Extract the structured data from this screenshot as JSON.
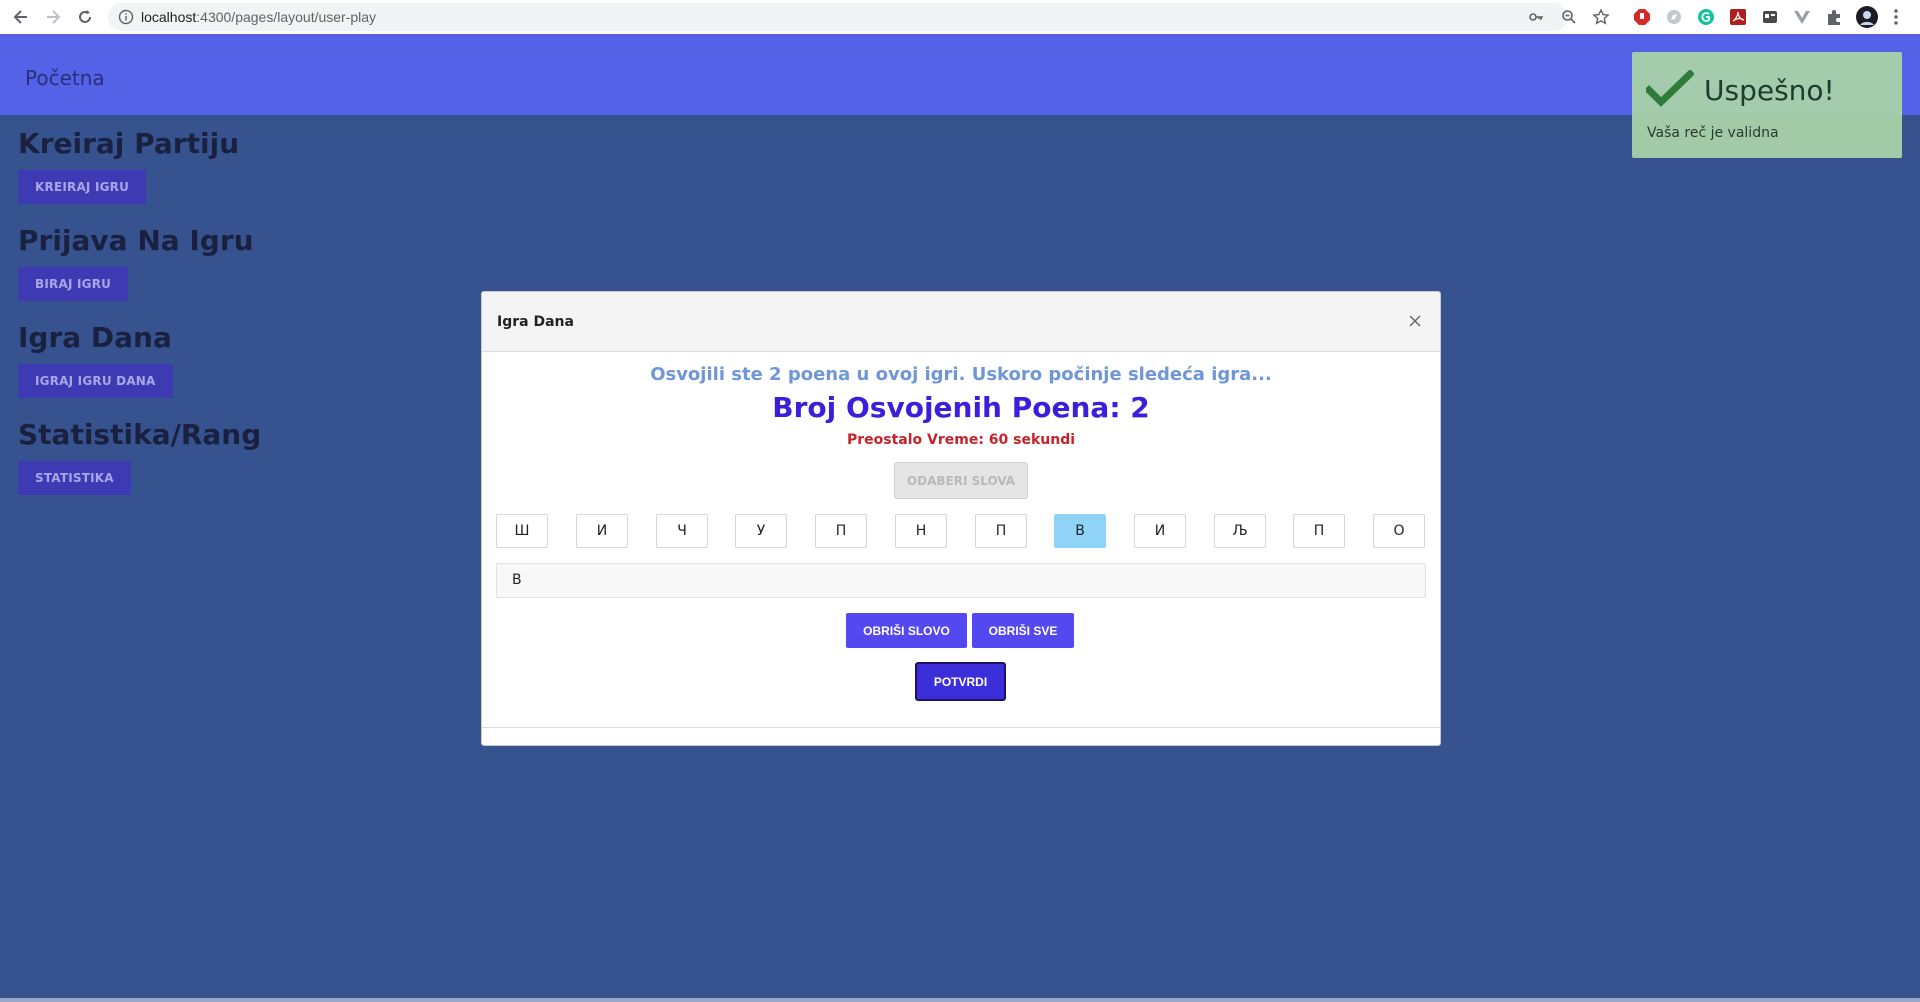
{
  "browser": {
    "url_host": "localhost",
    "url_path": ":4300/pages/layout/user-play"
  },
  "header": {
    "brand": "Početna"
  },
  "sections": [
    {
      "title": "Kreiraj Partiju",
      "button": "KREIRAJ IGRU"
    },
    {
      "title": "Prijava Na Igru",
      "button": "BIRAJ IGRU"
    },
    {
      "title": "Igra Dana",
      "button": "IGRAJ IGRU DANA"
    },
    {
      "title": "Statistika/Rang",
      "button": "STATISTIKA"
    }
  ],
  "modal": {
    "title": "Igra Dana",
    "info": "Osvojili ste 2 poena u ovoj igri. Uskoro počinje sledeća igra...",
    "score": "Broj Osvojenih Poena: 2",
    "time": "Preostalo Vreme: 60 sekundi",
    "pick_label": "ODABERI SLOVA",
    "letters": [
      "Ш",
      "И",
      "Ч",
      "У",
      "П",
      "Н",
      "П",
      "В",
      "И",
      "Љ",
      "П",
      "О"
    ],
    "selected_index": 7,
    "word_value": "В",
    "delete_letter_label": "OBRIŠI SLOVO",
    "delete_all_label": "OBRIŠI SVE",
    "confirm_label": "POTVRDI"
  },
  "toast": {
    "title": "Uspešno!",
    "message": "Vaša reč je validna"
  },
  "colors": {
    "page_bg": "#36538f",
    "header_bg": "#5462e7",
    "accent": "#5448f0",
    "toast_bg": "#a9d1a9"
  }
}
